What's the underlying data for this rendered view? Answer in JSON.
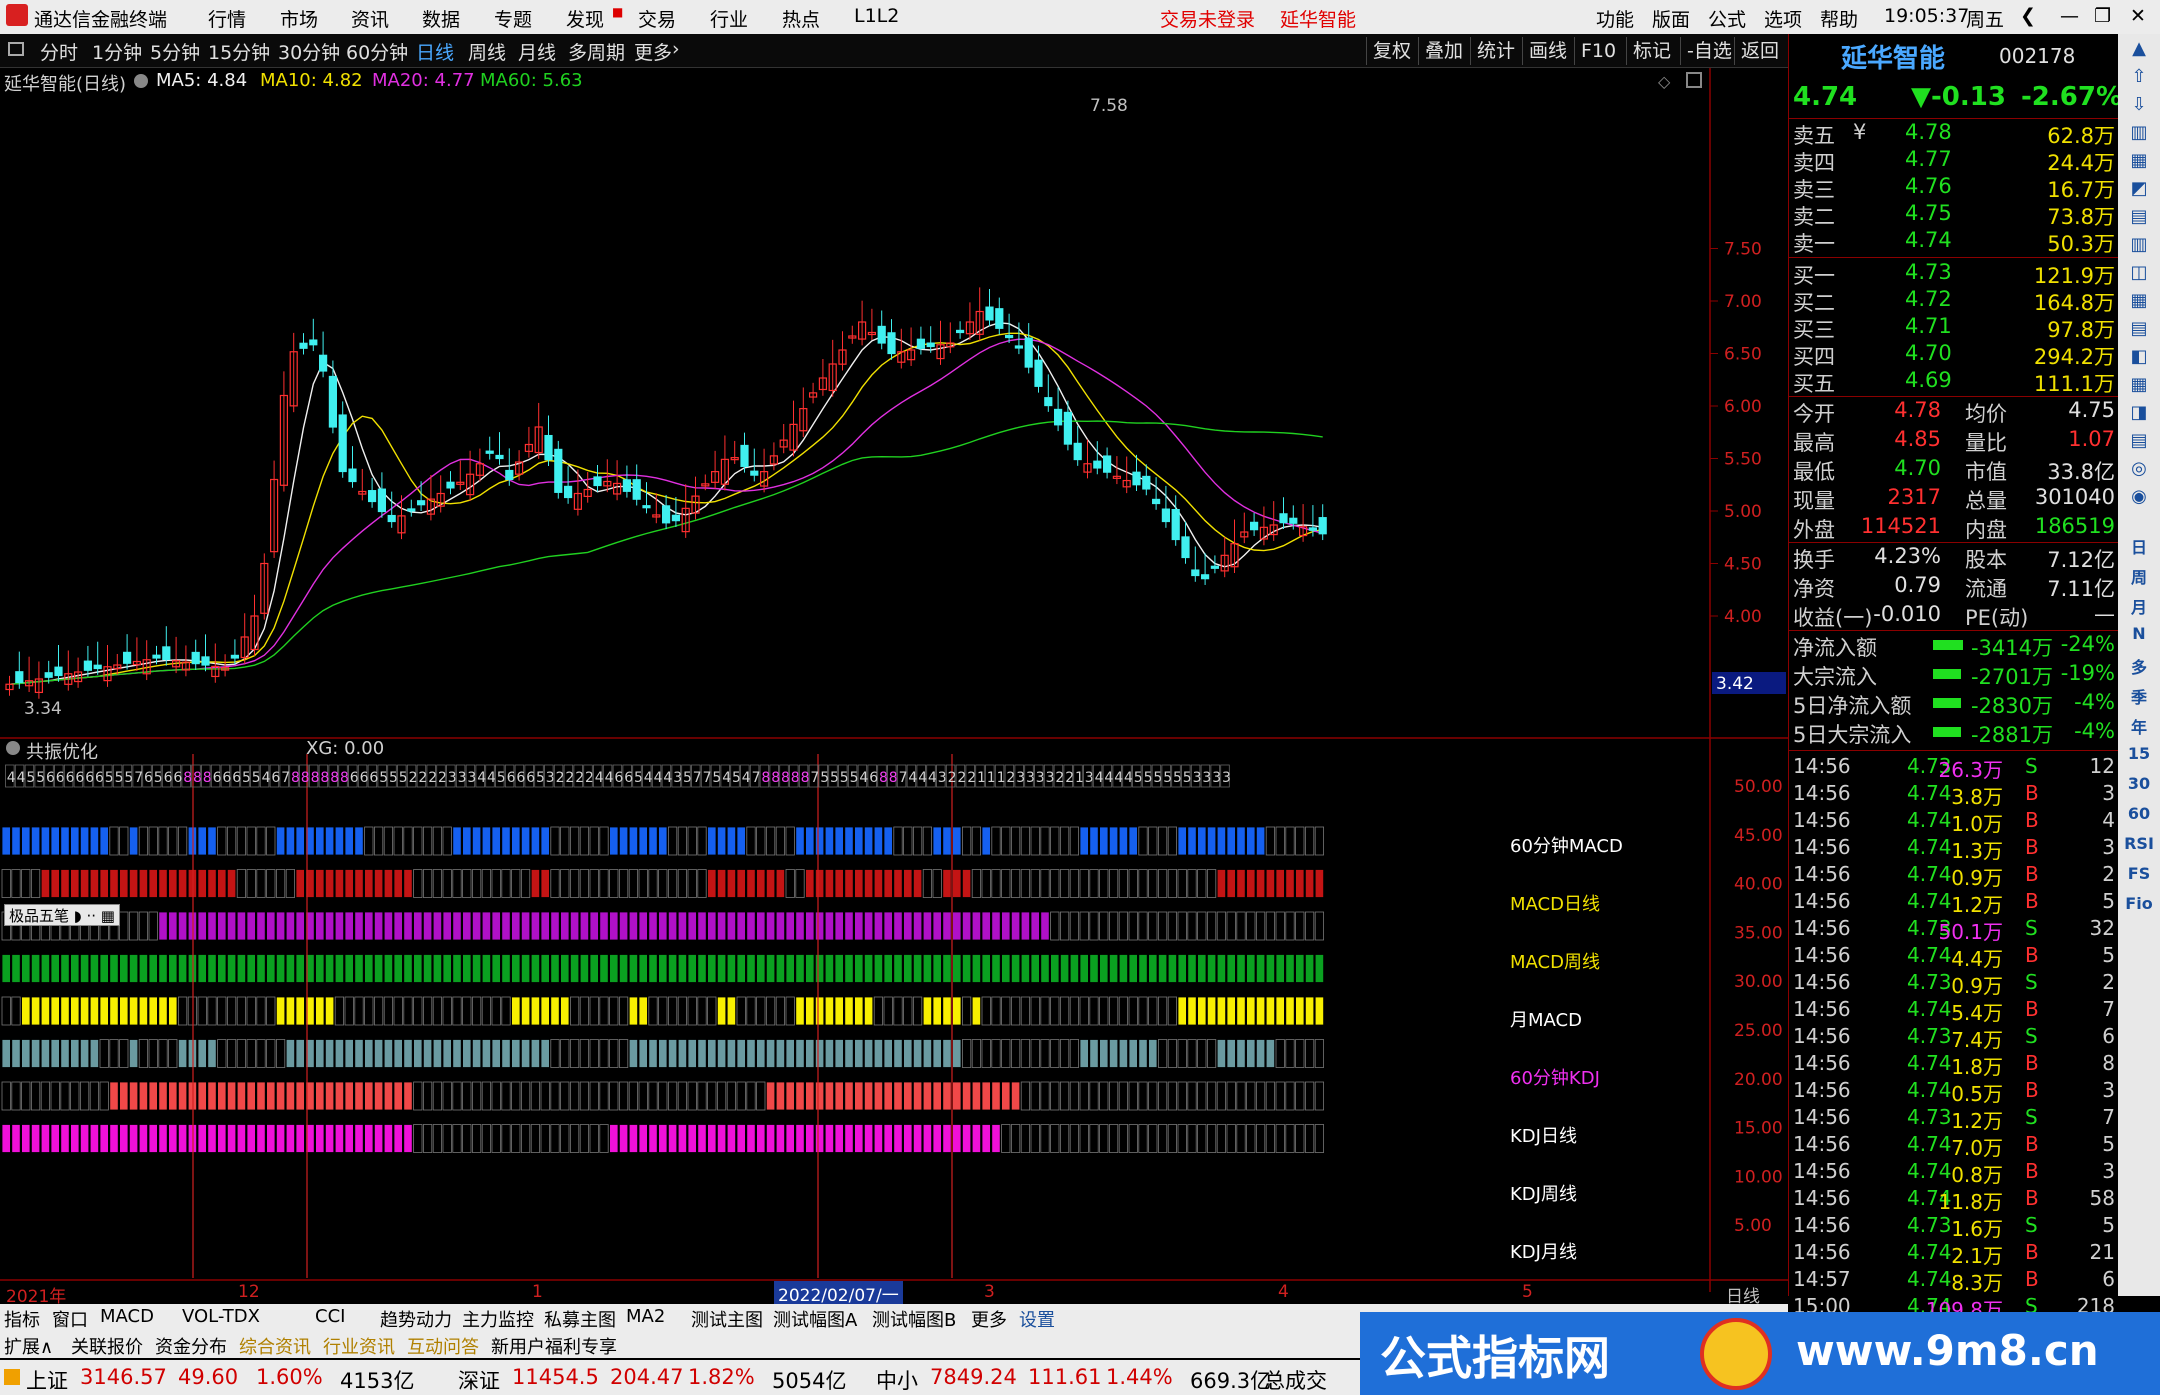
{
  "menubar": {
    "app_title": "通达信金融终端",
    "menus": [
      "行情",
      "市场",
      "资讯",
      "数据",
      "专题",
      "发现",
      "交易",
      "行业",
      "热点",
      "L1L2"
    ],
    "login_status": "交易未登录",
    "stock_name": "延华智能",
    "right_menus": [
      "功能",
      "版面",
      "公式",
      "选项",
      "帮助"
    ],
    "time": "19:05:37",
    "weekday": "周五"
  },
  "periodbar": {
    "periods": [
      "分时",
      "1分钟",
      "5分钟",
      "15分钟",
      "30分钟",
      "60分钟",
      "日线",
      "周线",
      "月线",
      "多周期",
      "更多"
    ],
    "active": "日线",
    "tools": [
      "复权",
      "叠加",
      "统计",
      "画线",
      "F10",
      "标记",
      "-自选",
      "返回"
    ]
  },
  "chart_info": {
    "title": "延华智能(日线)",
    "ma5": "MA5: 4.84",
    "ma10": "MA10: 4.82",
    "ma20": "MA20: 4.77",
    "ma60": "MA60: 5.63",
    "high_label": "7.58",
    "low_label": "3.34",
    "price_tag": "3.42",
    "indicator_title": "共振优化",
    "xg": "XG: 0.00",
    "date_cursor": "2022/02/07/一",
    "x_labels": [
      "2021年",
      "12",
      "1",
      "2",
      "3",
      "4",
      "5"
    ],
    "right_period": "日线",
    "float_label": "极品五笔"
  },
  "chart_data": {
    "type": "candlestick",
    "title": "延华智能(日线)",
    "y_ticks": [
      7.5,
      7.0,
      6.5,
      6.0,
      5.5,
      5.0,
      4.5,
      4.0
    ],
    "osc_ticks": [
      50,
      45,
      40,
      35,
      30,
      25,
      20,
      15,
      10,
      5
    ],
    "band_labels": [
      "60分钟MACD",
      "MACD日线",
      "MACD周线",
      "月MACD",
      "60分钟KDJ",
      "KDJ日线",
      "KDJ周线",
      "KDJ月线"
    ],
    "band_colors": [
      "#1560f0",
      "#c41414",
      "#b010c8",
      "#0aa020",
      "#f8f000",
      "#6a9aa0",
      "#f04848",
      "#f010d8"
    ],
    "digit_row": "44556666665557656688866655467888888666555222233344566653222244665444357754547888887555546887444322211123333221344445555553333"
  },
  "quote": {
    "name": "延华智能",
    "code": "002178",
    "price": "4.74",
    "change": "▼-0.13",
    "pct": "-2.67%",
    "asks": [
      {
        "label": "卖五",
        "price": "4.78",
        "vol": "62.8万"
      },
      {
        "label": "卖四",
        "price": "4.77",
        "vol": "24.4万"
      },
      {
        "label": "卖三",
        "price": "4.76",
        "vol": "16.7万"
      },
      {
        "label": "卖二",
        "price": "4.75",
        "vol": "73.8万"
      },
      {
        "label": "卖一",
        "price": "4.74",
        "vol": "50.3万"
      }
    ],
    "ask_mark": "¥",
    "bids": [
      {
        "label": "买一",
        "price": "4.73",
        "vol": "121.9万"
      },
      {
        "label": "买二",
        "price": "4.72",
        "vol": "164.8万"
      },
      {
        "label": "买三",
        "price": "4.71",
        "vol": "97.8万"
      },
      {
        "label": "买四",
        "price": "4.70",
        "vol": "294.2万"
      },
      {
        "label": "买五",
        "price": "4.69",
        "vol": "111.1万"
      }
    ],
    "stats": [
      [
        "今开",
        "4.78",
        "均价",
        "4.75"
      ],
      [
        "最高",
        "4.85",
        "量比",
        "1.07"
      ],
      [
        "最低",
        "4.70",
        "市值",
        "33.8亿"
      ],
      [
        "现量",
        "2317",
        "总量",
        "301040"
      ],
      [
        "外盘",
        "114521",
        "内盘",
        "186519"
      ]
    ],
    "stats2": [
      [
        "换手",
        "4.23%",
        "股本",
        "7.12亿"
      ],
      [
        "净资",
        "0.79",
        "流通",
        "7.11亿"
      ],
      [
        "收益(一)",
        "-0.010",
        "PE(动)",
        "—"
      ]
    ],
    "flows": [
      {
        "label": "净流入额",
        "val": "-3414万",
        "pct": "-24%"
      },
      {
        "label": "大宗流入",
        "val": "-2701万",
        "pct": "-19%"
      },
      {
        "label": "5日净流入额",
        "val": "-2830万",
        "pct": "-4%"
      },
      {
        "label": "5日大宗流入",
        "val": "-2881万",
        "pct": "-4%"
      }
    ],
    "ticks": [
      [
        "14:56",
        "4.73",
        "26.3万",
        "S",
        "12"
      ],
      [
        "14:56",
        "4.74",
        "3.8万",
        "B",
        "3"
      ],
      [
        "14:56",
        "4.74",
        "1.0万",
        "B",
        "4"
      ],
      [
        "14:56",
        "4.74",
        "1.3万",
        "B",
        "3"
      ],
      [
        "14:56",
        "4.74",
        "0.9万",
        "B",
        "2"
      ],
      [
        "14:56",
        "4.74",
        "1.2万",
        "B",
        "5"
      ],
      [
        "14:56",
        "4.73",
        "50.1万",
        "S",
        "32"
      ],
      [
        "14:56",
        "4.74",
        "4.4万",
        "B",
        "5"
      ],
      [
        "14:56",
        "4.73",
        "0.9万",
        "S",
        "2"
      ],
      [
        "14:56",
        "4.74",
        "5.4万",
        "B",
        "7"
      ],
      [
        "14:56",
        "4.73",
        "7.4万",
        "S",
        "6"
      ],
      [
        "14:56",
        "4.74",
        "1.8万",
        "B",
        "8"
      ],
      [
        "14:56",
        "4.74",
        "0.5万",
        "B",
        "3"
      ],
      [
        "14:56",
        "4.73",
        "1.2万",
        "S",
        "7"
      ],
      [
        "14:56",
        "4.74",
        "7.0万",
        "B",
        "5"
      ],
      [
        "14:56",
        "4.74",
        "0.8万",
        "B",
        "3"
      ],
      [
        "14:56",
        "4.74",
        "11.8万",
        "B",
        "58"
      ],
      [
        "14:56",
        "4.73",
        "1.6万",
        "S",
        "5"
      ],
      [
        "14:56",
        "4.74",
        "2.1万",
        "B",
        "21"
      ],
      [
        "14:57",
        "4.74",
        "8.3万",
        "B",
        "6"
      ],
      [
        "15:00",
        "4.74",
        "109.8万",
        "S",
        "218"
      ]
    ]
  },
  "right_tools": [
    "日",
    "周",
    "月",
    "N",
    "多",
    "季",
    "年",
    "15",
    "30",
    "60",
    "RSI",
    "FS",
    "Fio"
  ],
  "bottomtabs": [
    "指标",
    "窗口",
    "MACD",
    "VOL-TDX",
    "CCI",
    "趋势动力",
    "主力监控",
    "私募主图",
    "MA2",
    "测试主图",
    "测试幅图A",
    "测试幅图B",
    "更多",
    "设置"
  ],
  "bottomtabs2": [
    "扩展∧",
    "关联报价",
    "资金分布",
    "综合资讯",
    "行业资讯",
    "互动问答",
    "新用户福利专享"
  ],
  "statusbar": [
    {
      "name": "上证",
      "val": "3146.57",
      "chg": "49.60",
      "pct": "1.60%",
      "amt": "4153亿"
    },
    {
      "name": "深证",
      "val": "11454.5",
      "chg": "204.47",
      "pct": "1.82%",
      "amt": "5054亿"
    },
    {
      "name": "中小",
      "val": "7849.24",
      "chg": "111.61",
      "pct": "1.44%",
      "amt": "669.3亿"
    }
  ],
  "status_extra": "总成交",
  "banner": {
    "left": "公式指标网",
    "right": "www.9m8.cn"
  }
}
